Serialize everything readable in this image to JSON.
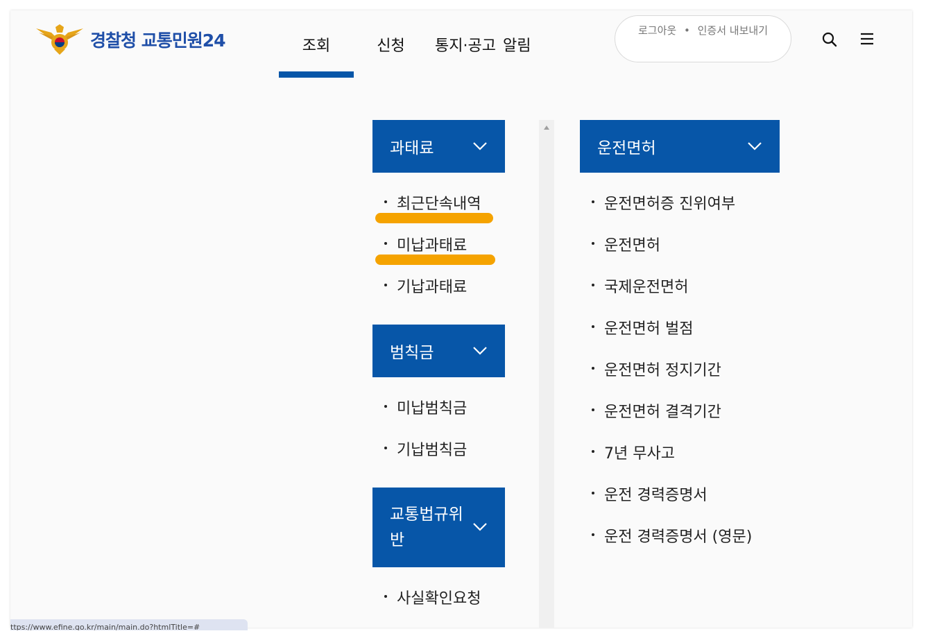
{
  "header": {
    "logo_text": "경찰청 교통민원24",
    "nav": [
      {
        "label": "조회",
        "active": true
      },
      {
        "label": "신청",
        "active": false
      },
      {
        "label": "통지·공고",
        "active": false
      },
      {
        "label": "알림",
        "active": false
      }
    ],
    "util": {
      "logout": "로그아웃",
      "separator": "•",
      "export_cert": "인증서 내보내기"
    },
    "icons": {
      "search": "search-icon",
      "menu": "hamburger-menu-icon"
    }
  },
  "sitemap": {
    "left": [
      {
        "title": "과태료",
        "items": [
          "최근단속내역",
          "미납과태료",
          "기납과태료"
        ]
      },
      {
        "title": "범칙금",
        "items": [
          "미납범칙금",
          "기납범칙금"
        ]
      },
      {
        "title": "교통법규위반",
        "items": [
          "사실확인요청"
        ]
      }
    ],
    "right": [
      {
        "title": "운전면허",
        "items": [
          "운전면허증 진위여부",
          "운전면허",
          "국제운전면허",
          "운전면허 벌점",
          "운전면허 정지기간",
          "운전면허 결격기간",
          "7년 무사고",
          "운전 경력증명서",
          "운전 경력증명서 (영문)"
        ]
      }
    ]
  },
  "status_bar": {
    "url": "ttps://www.efine.go.kr/main/main.do?htmlTitle=#"
  },
  "colors": {
    "primary": "#0756a8",
    "highlight": "#f5a300",
    "logo_text": "#1f4fa8"
  }
}
